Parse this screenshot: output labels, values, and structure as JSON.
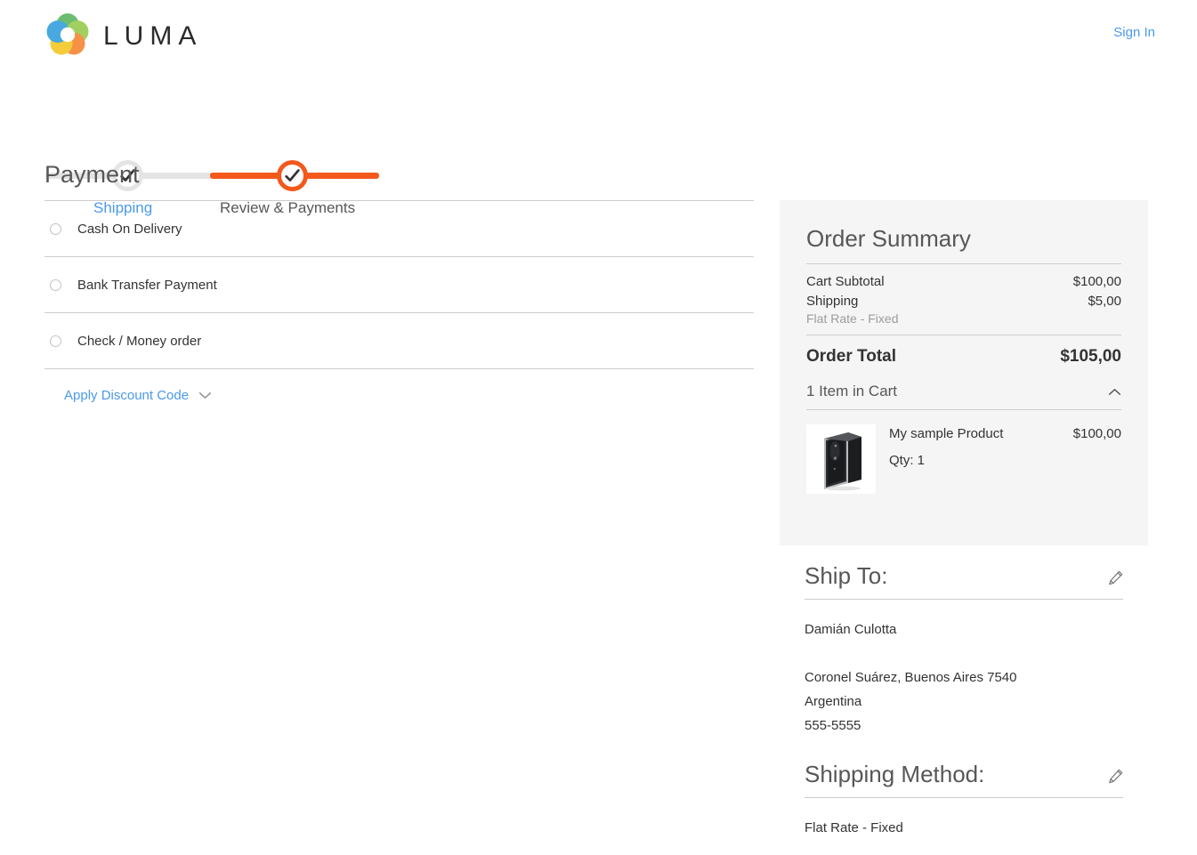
{
  "header": {
    "logo_text": "LUMA",
    "logo_icon": "luma-ring-logo",
    "sign_in_label": "Sign In"
  },
  "progress": {
    "steps": [
      {
        "label": "Shipping",
        "state": "completed",
        "icon": "check-icon"
      },
      {
        "label": "Review & Payments",
        "state": "current",
        "icon": "check-icon"
      }
    ],
    "colors": {
      "active": "#f4591c",
      "inactive": "#e4e4e4",
      "link": "#4a9ae8"
    }
  },
  "payment": {
    "title": "Payment",
    "methods": [
      {
        "label": "Cash On Delivery",
        "selected": false
      },
      {
        "label": "Bank Transfer Payment",
        "selected": false
      },
      {
        "label": "Check / Money order",
        "selected": false
      }
    ],
    "discount": {
      "label": "Apply Discount Code",
      "icon": "chevron-down-icon",
      "expanded": false
    }
  },
  "order_summary": {
    "title": "Order Summary",
    "rows": [
      {
        "label": "Cart Subtotal",
        "value": "$100,00",
        "sub": null
      },
      {
        "label": "Shipping",
        "value": "$5,00",
        "sub": "Flat Rate - Fixed"
      }
    ],
    "total": {
      "label": "Order Total",
      "value": "$105,00"
    },
    "cart_toggle": {
      "label": "1 Item in Cart",
      "icon": "chevron-up-icon",
      "expanded": true
    },
    "items": [
      {
        "image": "product-thumbnail",
        "name": "My sample Product",
        "qty": "Qty: 1",
        "price": "$100,00"
      }
    ]
  },
  "ship_to": {
    "title": "Ship To:",
    "edit_icon": "pencil-edit-icon",
    "name": "Damián Culotta",
    "street": "Coronel Suárez, Buenos Aires 7540",
    "country": "Argentina",
    "phone": "555-5555"
  },
  "shipping_method": {
    "title": "Shipping Method:",
    "edit_icon": "pencil-edit-icon",
    "value": "Flat Rate - Fixed"
  }
}
